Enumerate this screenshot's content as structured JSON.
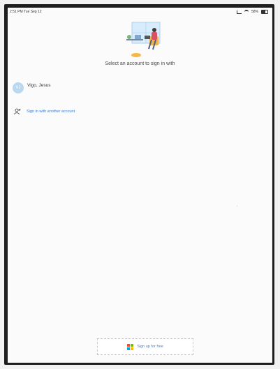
{
  "status_bar": {
    "time_date": "2:51 PM  Tue Sep 12",
    "battery_percent": "58%",
    "icons": [
      "signal-icon",
      "wifi-icon",
      "battery-icon"
    ]
  },
  "sign_in": {
    "prompt": "Select an account to sign in with",
    "account": {
      "initials": "VJ",
      "name": "Vigo, Jesus"
    },
    "work_account_link": "Sign in with another account",
    "signup_button": "Sign up for free"
  },
  "colors": {
    "link": "#3a7bd5",
    "avatar_bg": "#b8d8f2",
    "app_icon": [
      "#f25022",
      "#7fba00",
      "#00a4ef",
      "#ffb900"
    ]
  }
}
